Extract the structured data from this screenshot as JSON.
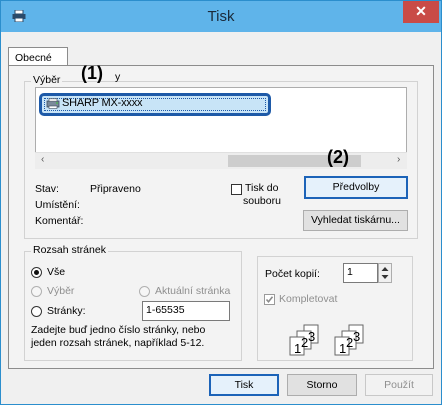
{
  "window": {
    "title": "Tisk",
    "close_glyph": "✕",
    "app_icon": "printer-icon"
  },
  "tabs": [
    {
      "label": "Obecné"
    }
  ],
  "printer_group": {
    "legend": "Výběr",
    "legend_trail": "y",
    "selected_printer": "SHARP MX-xxxx",
    "scroll_left": "‹",
    "scroll_right": "›",
    "status_label": "Stav:",
    "status_value": "Připraveno",
    "location_label": "Umístění:",
    "comment_label": "Komentář:",
    "print_to_file_a": "Tisk do",
    "print_to_file_b": "souboru",
    "preferences_button": "Předvolby",
    "find_printer_button": "Vyhledat tiskárnu..."
  },
  "page_range": {
    "legend": "Rozsah stránek",
    "all": "Vše",
    "selection": "Výběr",
    "current_page": "Aktuální stránka",
    "pages": "Stránky:",
    "pages_value": "1-65535",
    "hint_line1": "Zadejte buď jedno číslo stránky, nebo",
    "hint_line2": "jeden rozsah stránek, například 5-12."
  },
  "copies": {
    "label": "Počet kopií:",
    "value": "1",
    "collate": "Kompletovat",
    "collate_digits": [
      "1",
      "2",
      "3"
    ]
  },
  "callouts": {
    "one": "(1)",
    "two": "(2)"
  },
  "footer": {
    "print_button": "Tisk",
    "cancel_button": "Storno",
    "apply_button": "Použít"
  }
}
